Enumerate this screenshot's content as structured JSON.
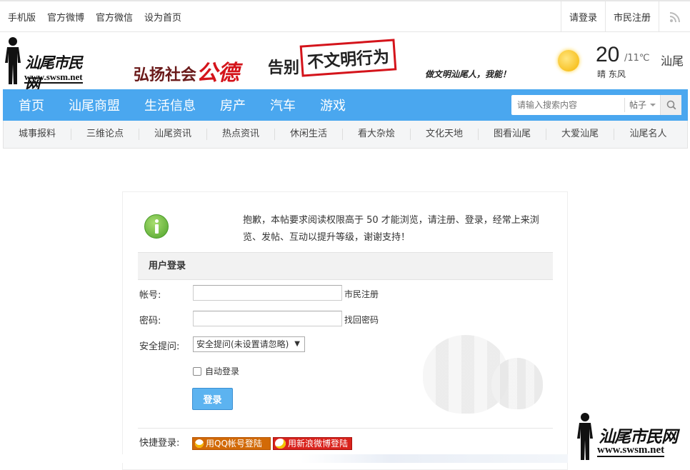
{
  "topbar": {
    "links": [
      "手机版",
      "官方微博",
      "官方微信",
      "设为首页"
    ],
    "login": "请登录",
    "register": "市民注册"
  },
  "logo": {
    "cn": "汕尾市民网",
    "en": "www.swsm.net"
  },
  "banner": {
    "part1": "弘扬社会",
    "part1_big": "公德",
    "part2": "告别",
    "part3": "不文明行为",
    "slogan": "做文明汕尾人，我能！"
  },
  "weather": {
    "temp": "20",
    "range": "/11℃",
    "city": "汕尾",
    "desc": "晴  东风"
  },
  "nav": {
    "items": [
      "首页",
      "汕尾商盟",
      "生活信息",
      "房产",
      "汽车",
      "游戏"
    ],
    "search_placeholder": "请输入搜索内容",
    "search_type": "帖子"
  },
  "subnav": [
    "城事报料",
    "三维论点",
    "汕尾资讯",
    "热点资讯",
    "休闲生活",
    "看大杂烩",
    "文化天地",
    "图看汕尾",
    "大爱汕尾",
    "汕尾名人"
  ],
  "message": "抱歉，本帖要求阅读权限高于 50 才能浏览，请注册、登录，经常上来浏览、发帖、互动以提升等级，谢谢支持！",
  "login": {
    "title": "用户登录",
    "account_label": "帐号:",
    "account_link": "市民注册",
    "password_label": "密码:",
    "password_link": "找回密码",
    "question_label": "安全提问:",
    "question_value": "安全提问(未设置请忽略)",
    "auto_login": "自动登录",
    "submit": "登录",
    "quick_label": "快捷登录:",
    "qq": "用QQ帐号登陆",
    "weibo": "用新浪微博登陆"
  },
  "watermark": {
    "cn": "汕尾市民网",
    "en": "www.swsm.net"
  },
  "colors": {
    "nav": "#4aa7ef",
    "accent_red": "#d4141b",
    "button": "#5cb3f0"
  }
}
